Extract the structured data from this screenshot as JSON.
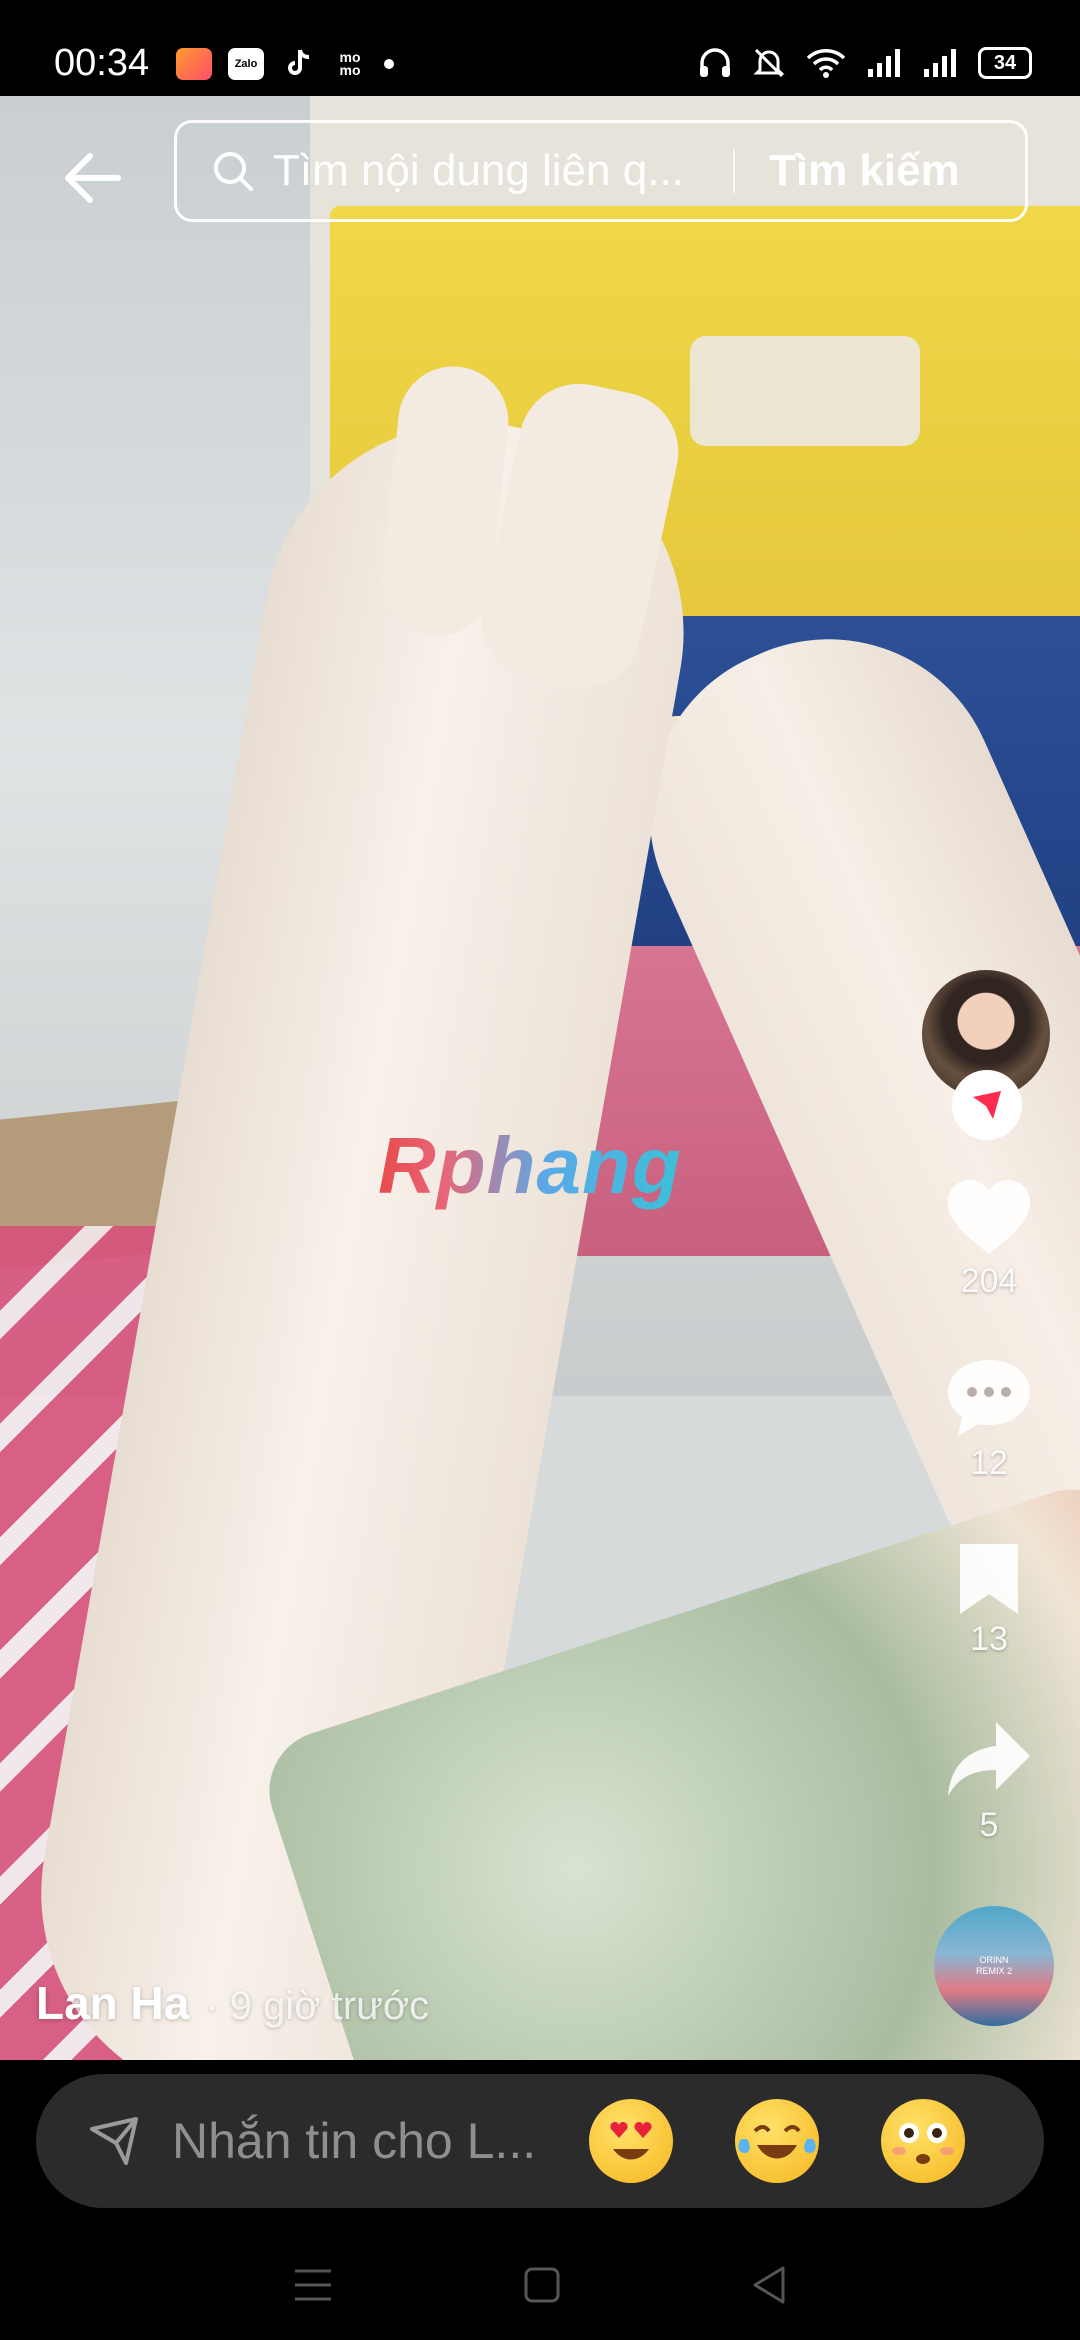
{
  "status_bar": {
    "time": "00:34",
    "left_icons": [
      "gallery-app-icon",
      "zalo-app-icon",
      "tiktok-app-icon",
      "momo-app-icon",
      "notification-dot"
    ],
    "app_labels": {
      "zalo": "Zalo",
      "momo": "mo mo"
    },
    "right_icons": [
      "headphones-icon",
      "mute-icon",
      "wifi-icon",
      "signal-icon",
      "signal-icon"
    ],
    "battery": "34"
  },
  "header": {
    "back_icon": "arrow-left-icon",
    "search_placeholder": "Tìm nội dung liên q...",
    "search_button": "Tìm kiếm"
  },
  "video": {
    "watermark": "Rphang",
    "author": "Lan Ha",
    "time_ago": "· 9 giờ trước"
  },
  "actions": {
    "likes": "204",
    "comments": "12",
    "saves": "13",
    "shares": "5"
  },
  "music": {
    "disc_label_1": "ORINN",
    "disc_label_2": "REMIX 2"
  },
  "composer": {
    "placeholder": "Nhắn tin cho L...",
    "emojis": [
      "heart-eyes-emoji",
      "tears-of-joy-emoji",
      "flushed-emoji"
    ]
  },
  "colors": {
    "accent_red": "#ff2b4f",
    "bar_background": "#2b2b2b"
  }
}
